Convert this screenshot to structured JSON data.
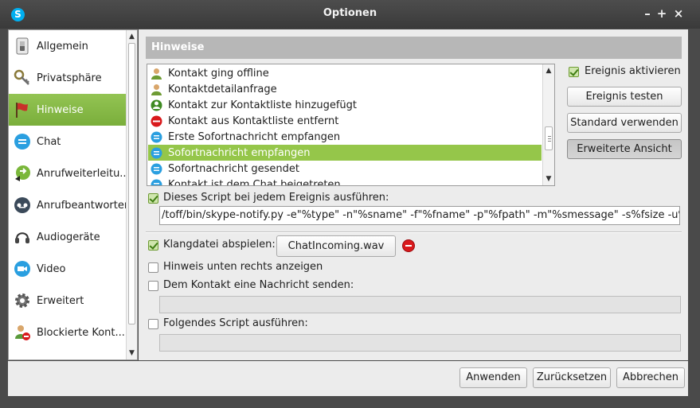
{
  "window": {
    "title": "Optionen",
    "app_icon_letter": "S",
    "minimize_glyph": "–",
    "maximize_glyph": "+",
    "close_glyph": "×"
  },
  "sidebar": {
    "items": [
      {
        "label": "Allgemein",
        "icon": "switch-icon"
      },
      {
        "label": "Privatsphäre",
        "icon": "key-icon"
      },
      {
        "label": "Hinweise",
        "icon": "flag-icon",
        "active": true
      },
      {
        "label": "Chat",
        "icon": "chat-icon"
      },
      {
        "label": "Anrufweiterleitu...",
        "icon": "call-forward-icon"
      },
      {
        "label": "Anrufbeantworter",
        "icon": "voicemail-icon"
      },
      {
        "label": "Audiogeräte",
        "icon": "headset-icon"
      },
      {
        "label": "Video",
        "icon": "video-icon"
      },
      {
        "label": "Erweitert",
        "icon": "gear-icon"
      },
      {
        "label": "Blockierte Kont...",
        "icon": "blocked-contact-icon"
      }
    ]
  },
  "section": {
    "title": "Hinweise"
  },
  "events": {
    "items": [
      {
        "label": "Kontakt ging offline",
        "icon": "contact-icon"
      },
      {
        "label": "Kontaktdetailanfrage",
        "icon": "contact-icon"
      },
      {
        "label": "Kontakt zur Kontaktliste hinzugefügt",
        "icon": "add-contact-icon"
      },
      {
        "label": "Kontakt aus Kontaktliste entfernt",
        "icon": "remove-icon"
      },
      {
        "label": "Erste Sofortnachricht empfangen",
        "icon": "chat-icon"
      },
      {
        "label": "Sofortnachricht empfangen",
        "icon": "chat-icon",
        "selected": true
      },
      {
        "label": "Sofortnachricht gesendet",
        "icon": "chat-icon"
      },
      {
        "label": "Kontakt ist dem Chat beigetreten",
        "icon": "chat-icon"
      }
    ]
  },
  "side_controls": {
    "enable_event_label": "Ereignis aktivieren",
    "enable_event_checked": true,
    "test_event_label": "Ereignis testen",
    "use_default_label": "Standard verwenden",
    "advanced_view_label": "Erweiterte Ansicht"
  },
  "script_every_event": {
    "label": "Dieses Script bei jedem Ereignis ausführen:",
    "checked": true,
    "value": "/toff/bin/skype-notify.py -e\"%type\" -n\"%sname\" -f\"%fname\" -p\"%fpath\" -m\"%smessage\" -s%fsize -u%sskype"
  },
  "sound_file": {
    "label": "Klangdatei abspielen:",
    "checked": true,
    "file_name": "ChatIncoming.wav"
  },
  "show_hint": {
    "label": "Hinweis unten rechts anzeigen",
    "checked": false
  },
  "send_message": {
    "label": "Dem Kontakt eine Nachricht senden:",
    "checked": false,
    "value": ""
  },
  "run_script": {
    "label": "Folgendes Script ausführen:",
    "checked": false,
    "value": ""
  },
  "footer": {
    "apply_label": "Anwenden",
    "reset_label": "Zurücksetzen",
    "cancel_label": "Abbrechen"
  },
  "colors": {
    "accent_green": "#95c64a",
    "section_header": "#b7b7b7",
    "title_bar": "#3f3f3f"
  }
}
